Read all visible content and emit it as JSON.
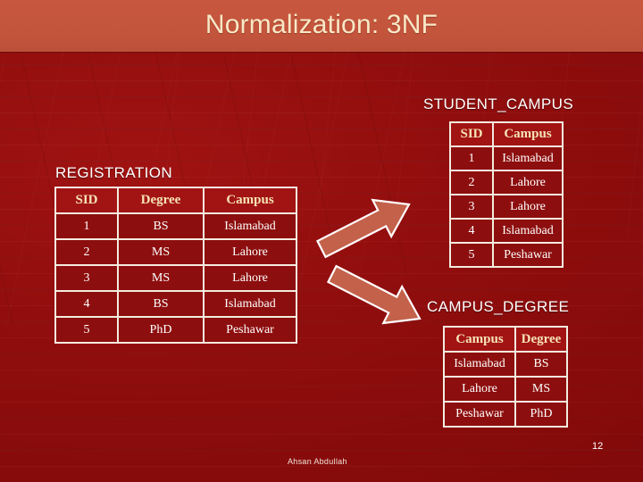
{
  "slide": {
    "title": "Normalization: 3NF",
    "page_number": "12",
    "author": "Ahsan Abdullah",
    "colors": {
      "header_band": "#c4553d",
      "title_text": "#f8e8c6",
      "background": "#8f0d0d",
      "table_border": "#f3ece0",
      "table_header_text": "#f6e3b4",
      "table_cell_text": "#ffffff",
      "arrow_fill": "#c4614a",
      "arrow_outline": "#ffffff"
    }
  },
  "tables": {
    "registration": {
      "label": "REGISTRATION",
      "columns": [
        "SID",
        "Degree",
        "Campus"
      ],
      "rows": [
        [
          "1",
          "BS",
          "Islamabad"
        ],
        [
          "2",
          "MS",
          "Lahore"
        ],
        [
          "3",
          "MS",
          "Lahore"
        ],
        [
          "4",
          "BS",
          "Islamabad"
        ],
        [
          "5",
          "PhD",
          "Peshawar"
        ]
      ]
    },
    "student_campus": {
      "label": "STUDENT_CAMPUS",
      "columns": [
        "SID",
        "Campus"
      ],
      "rows": [
        [
          "1",
          "Islamabad"
        ],
        [
          "2",
          "Lahore"
        ],
        [
          "3",
          "Lahore"
        ],
        [
          "4",
          "Islamabad"
        ],
        [
          "5",
          "Peshawar"
        ]
      ]
    },
    "campus_degree": {
      "label": "CAMPUS_DEGREE",
      "columns": [
        "Campus",
        "Degree"
      ],
      "rows": [
        [
          "Islamabad",
          "BS"
        ],
        [
          "Lahore",
          "MS"
        ],
        [
          "Peshawar",
          "PhD"
        ]
      ]
    }
  },
  "arrows": [
    {
      "name": "arrow-up-right",
      "direction": "up-right"
    },
    {
      "name": "arrow-down-right",
      "direction": "down-right"
    }
  ]
}
